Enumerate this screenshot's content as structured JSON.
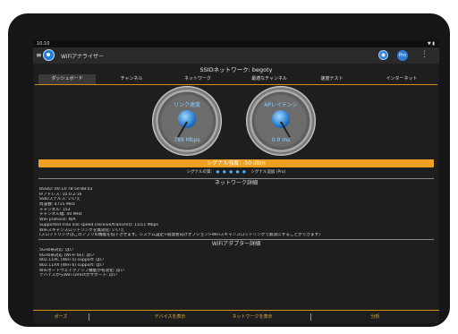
{
  "status": {
    "time": "10:10"
  },
  "app": {
    "title": "WiFiアナライザー",
    "pro_label": "Pro",
    "menu_icon": "hamburger-icon",
    "info_icon": "wifi-info-icon",
    "overflow_icon": "more-vert-icon"
  },
  "ssid_line": "SSIDネットワーク: begoty",
  "tabs": [
    "ダッシュボード",
    "チャンネル",
    "ネットワーク",
    "最適なチャンネル",
    "速度テスト",
    "インターネット"
  ],
  "gauges": [
    {
      "label": "リンク速度",
      "value": "788 Mbps"
    },
    {
      "label": "APレイテンシ",
      "value": "0.0 ms"
    }
  ],
  "signal": {
    "text": "シグナル強度: -50 dBm",
    "quality_label": "シグナルの質:",
    "quality_dots": "● ● ● ● ●",
    "detect_label": "シグナル追加 (Pro)"
  },
  "network_details": {
    "title": "ネットワーク詳細",
    "rows": [
      "BSSID: 00:14:78:5e:88:02",
      "IPアドレス: 10.0.2.16",
      "SSIDステルス: いいえ",
      "周波数: 4715 MHz",
      "チャンネル: 153",
      "チャンネル幅: 40 MHz",
      "WiFi protocol: N/A",
      "Supported max link speed (receive/transmit): 11/11 Mbps",
      "WiFiスキャンスロットリングを無効化: いいえ",
      "(スロットリングはこのアプリの機能を低下させます。システム設定>開発者向けオプション>WiFiスキャンスロットリングで無効にすることができます)"
    ]
  },
  "adapter_details": {
    "title": "WiFiアダプター詳細",
    "rows": [
      "5GHz帯対応: はい",
      "6GHz帯対応 (Wi-Fi 6E): はい",
      "802.11AC (WiFi 5) support: はい",
      "802.11AX (WiFi 6) support: はい",
      "WiFiオートウェイクアップ機能が有効化: はい",
      "デバイスからWiFi Directがサポート: はい"
    ]
  },
  "footer": [
    "ポーズ",
    "デバイスを表示",
    "ネットワークを表示",
    "分析"
  ],
  "colors": {
    "accent": "#d48f1a",
    "signal_bar": "#f0a020",
    "gauge_text": "#8fd0ff"
  }
}
